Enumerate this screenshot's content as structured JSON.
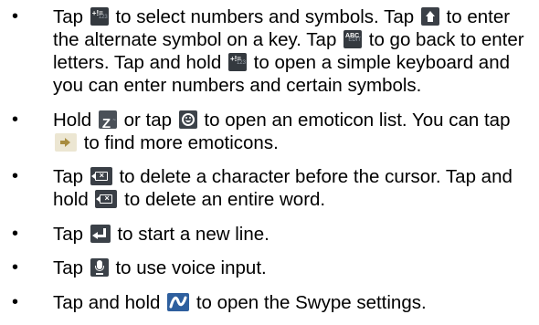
{
  "bullets": [
    {
      "parts": [
        "Tap",
        "to select numbers and symbols. Tap",
        "to enter the alternate symbol on a key. Tap",
        "to go back to enter letters. Tap and hold",
        "to open a simple keyboard and you can enter numbers and certain symbols."
      ],
      "icons": [
        "numbers-symbols-key-icon",
        "shift-alt-key-icon",
        "abc-letters-key-icon",
        "numbers-symbols-key-icon"
      ]
    },
    {
      "parts": [
        "Hold",
        "or tap",
        "to open an emoticon list. You can tap",
        "to find more emoticons."
      ],
      "icons": [
        "z-key-icon",
        "smiley-key-icon",
        "more-arrow-icon"
      ]
    },
    {
      "parts": [
        "Tap",
        "to delete a character before the cursor. Tap and hold",
        "to delete an entire word."
      ],
      "icons": [
        "delete-key-icon",
        "delete-key-icon"
      ]
    },
    {
      "parts": [
        "Tap",
        "to start a new line."
      ],
      "icons": [
        "enter-key-icon"
      ]
    },
    {
      "parts": [
        "Tap",
        "to use voice input."
      ],
      "icons": [
        "microphone-key-icon"
      ]
    },
    {
      "parts": [
        "Tap and hold",
        "to open the Swype settings."
      ],
      "icons": [
        "swype-key-icon"
      ]
    }
  ],
  "key_labels": {
    "num_sup": "123",
    "num_main": "+!=",
    "abc_sup": "EDIT",
    "abc_main": "ABC",
    "z_main": "Z",
    "z_sup": "~"
  },
  "bullet_glyph": "•",
  "colors": {
    "text": "#000000",
    "key_dark": "#34393f",
    "swype_blue": "#2e5f9e",
    "more_bg": "#ece6d2"
  }
}
